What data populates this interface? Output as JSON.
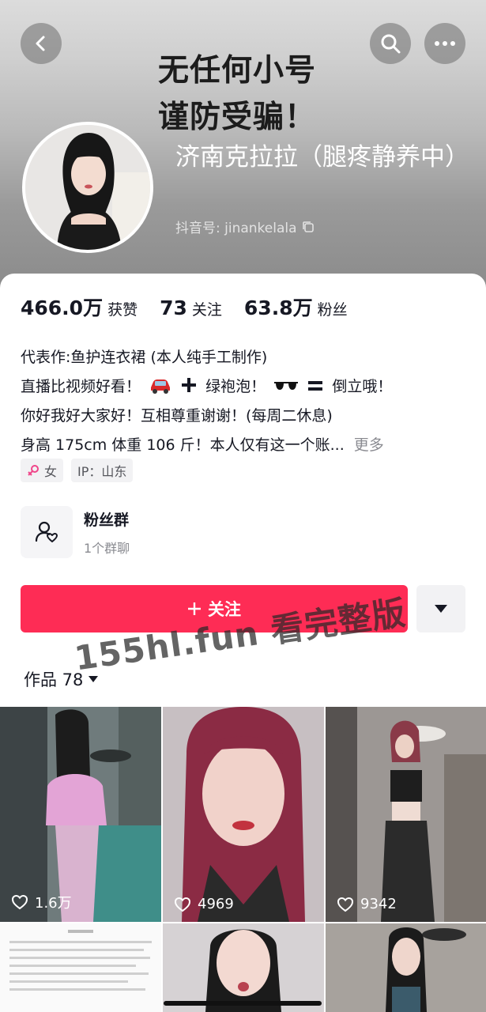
{
  "header": {
    "banner_line1": "无任何小号",
    "banner_line2": "谨防受骗！",
    "nickname": "济南克拉拉（腿疼静养中）",
    "douyin_id_label": "抖音号: jinankelala"
  },
  "stats": {
    "likes_value": "466.0万",
    "likes_label": "获赞",
    "following_value": "73",
    "following_label": "关注",
    "followers_value": "63.8万",
    "followers_label": "粉丝"
  },
  "bio": {
    "line1": "代表作:鱼护连衣裙 (本人纯手工制作)",
    "line2_a": "直播比视频好看！",
    "line2_b": "绿袍泡！",
    "line2_c": "倒立哦！",
    "line3": "你好我好大家好！互相尊重谢谢！(每周二休息)",
    "line4": "身高 175cm 体重 106 斤！本人仅有这一个账...",
    "more_label": "更多"
  },
  "tags": {
    "gender": "女",
    "ip": "IP：山东"
  },
  "fan_group": {
    "title": "粉丝群",
    "subtitle": "1个群聊"
  },
  "actions": {
    "follow_label": "关注"
  },
  "works": {
    "tab_label": "作品 78"
  },
  "watermark": "155hl.fun 看完整版",
  "videos": [
    {
      "likes": "1.6万"
    },
    {
      "likes": "4969"
    },
    {
      "likes": "9342"
    }
  ],
  "colors": {
    "accent": "#fe2c55",
    "text_primary": "#161823",
    "text_secondary": "#8a8b91"
  },
  "icons": [
    "back-icon",
    "search-icon",
    "more-icon",
    "copy-icon",
    "female-icon",
    "fan-group-icon",
    "plus-icon",
    "caret-down-icon",
    "heart-icon"
  ]
}
